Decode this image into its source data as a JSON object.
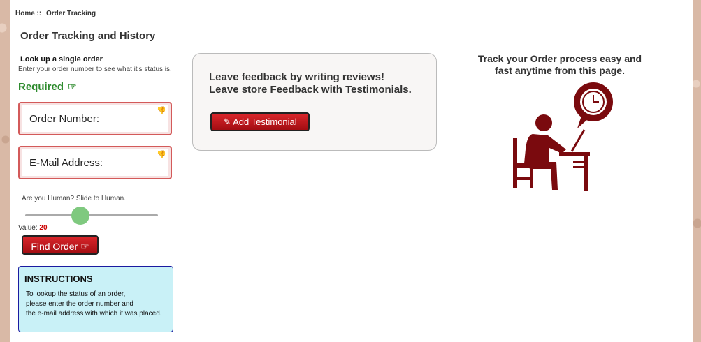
{
  "breadcrumb": {
    "home": "Home ::",
    "current": "Order Tracking"
  },
  "page_title": "Order Tracking and History",
  "lookup": {
    "title": "Look up a single order",
    "description": "Enter your order number to see what it's status is.",
    "required_label": "Required",
    "required_icon": "hand-pointing-icon",
    "order_number_label": "Order Number:",
    "email_label": "E-Mail Address:",
    "field_icon": "thumbs-down-icon",
    "human_prompt": "Are you Human? Slide to Human..",
    "value_label": "Value:",
    "slider_value": "20",
    "find_button": "Find Order"
  },
  "instructions": {
    "title": "INSTRUCTIONS",
    "lines": [
      "To lookup the status of an order,",
      "please enter the order number and",
      "the e-mail address with which it was placed."
    ]
  },
  "feedback": {
    "line1": "Leave feedback by writing reviews!",
    "line2": "Leave store Feedback with Testimonials.",
    "button": "Add Testimonial"
  },
  "tracking": {
    "line1": "Track your Order process easy and",
    "line2": "fast anytime from this page."
  },
  "colors": {
    "accent_red": "#a30d12",
    "required_green": "#2e8b2e",
    "instructions_bg": "#c9f1f7",
    "illustration": "#7a0a0e"
  }
}
